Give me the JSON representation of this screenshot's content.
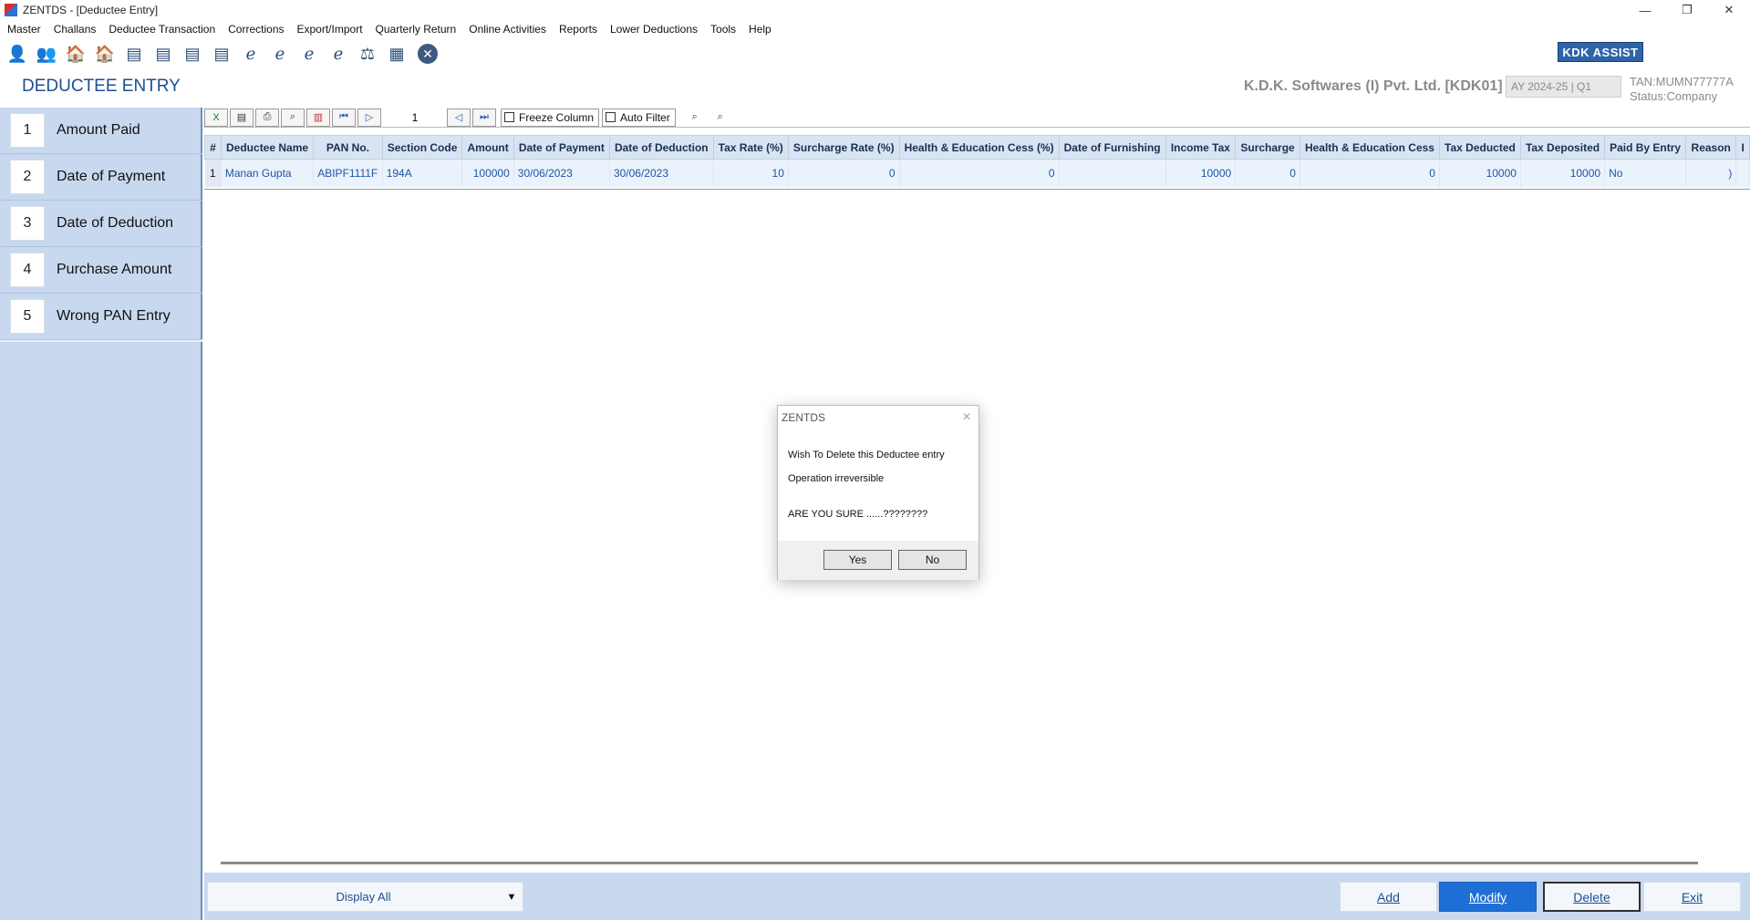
{
  "window": {
    "title": "ZENTDS - [Deductee Entry]",
    "controls": [
      "—",
      "❐",
      "✕"
    ]
  },
  "menu": [
    "Master",
    "Challans",
    "Deductee Transaction",
    "Corrections",
    "Export/Import",
    "Quarterly Return",
    "Online Activities",
    "Reports",
    "Lower Deductions",
    "Tools",
    "Help"
  ],
  "toolbar": {
    "icons": [
      {
        "name": "deductor-icon",
        "glyph": "👤"
      },
      {
        "name": "deductees-icon",
        "glyph": "👥"
      },
      {
        "name": "deductee-master-icon",
        "glyph": "🏠"
      },
      {
        "name": "employee-master-icon",
        "glyph": "🏠"
      },
      {
        "name": "form-24q-icon",
        "glyph": "▤"
      },
      {
        "name": "form-26q-icon",
        "glyph": "▤"
      },
      {
        "name": "form-27q-icon",
        "glyph": "▤"
      },
      {
        "name": "form-27eq-icon",
        "glyph": "▤"
      },
      {
        "name": "e-24q-icon",
        "glyph": "ℯ"
      },
      {
        "name": "e-26q-icon",
        "glyph": "ℯ"
      },
      {
        "name": "e-27q-icon",
        "glyph": "ℯ"
      },
      {
        "name": "e-27eq-icon",
        "glyph": "ℯ"
      },
      {
        "name": "tds-icon",
        "glyph": "⚖"
      },
      {
        "name": "calculator-icon",
        "glyph": "▦"
      }
    ],
    "close_glyph": "✕",
    "assist_label": "KDK ASSIST"
  },
  "header": {
    "page_title": "DEDUCTEE ENTRY",
    "company": "K.D.K. Softwares (I) Pvt. Ltd. [KDK01]",
    "ay": "AY 2024-25 | Q1",
    "tan": "TAN:MUMN77777A",
    "status": "Status:Company"
  },
  "sidebar": {
    "items": [
      {
        "num": "1",
        "label": "Amount Paid"
      },
      {
        "num": "2",
        "label": "Date of Payment"
      },
      {
        "num": "3",
        "label": "Date of Deduction"
      },
      {
        "num": "4",
        "label": "Purchase Amount"
      },
      {
        "num": "5",
        "label": "Wrong PAN Entry"
      }
    ]
  },
  "grid_toolbar": {
    "page": "1",
    "freeze_label": "Freeze Column",
    "autofilter_label": "Auto Filter"
  },
  "table": {
    "headers": [
      "#",
      "Deductee Name",
      "PAN No.",
      "Section Code",
      "Amount",
      "Date of Payment",
      "Date of Deduction",
      "Tax Rate (%)",
      "Surcharge Rate (%)",
      "Health & Education Cess (%)",
      "Date of Furnishing",
      "Income Tax",
      "Surcharge",
      "Health & Education Cess",
      "Tax Deducted",
      "Tax Deposited",
      "Paid By Entry",
      "Reason",
      "I"
    ],
    "rows": [
      [
        "1",
        "Manan Gupta",
        "ABIPF1111F",
        "194A",
        "100000",
        "30/06/2023",
        "30/06/2023",
        "10",
        "0",
        "0",
        "",
        "10000",
        "0",
        "0",
        "10000",
        "10000",
        "No",
        ")",
        ""
      ]
    ]
  },
  "footer": {
    "display_value": "Display All",
    "add": "Add",
    "modify": "Modify",
    "delete": "Delete",
    "exit": "Exit"
  },
  "dialog": {
    "title": "ZENTDS",
    "close": "✕",
    "line1": "Wish To Delete this Deductee entry",
    "line2": "Operation irreversible",
    "line3": "ARE YOU SURE ......????????",
    "yes": "Yes",
    "no": "No"
  }
}
